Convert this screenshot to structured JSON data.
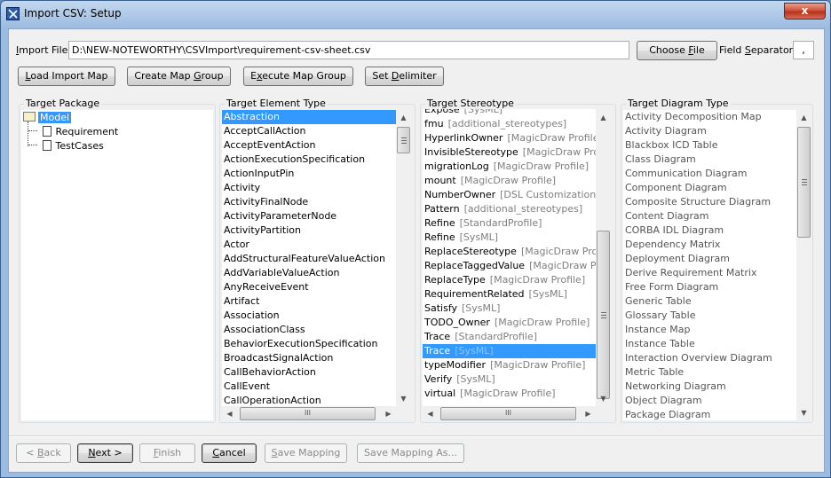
{
  "window": {
    "title": "Import CSV: Setup",
    "close_label": "x"
  },
  "import_file": {
    "label_pre": "",
    "label_u": "I",
    "label_post": "mport File:",
    "value": "D:\\NEW-NOTEWORTHY\\CSVImport\\requirement-csv-sheet.csv"
  },
  "choose_file": {
    "pre": "Choose ",
    "u": "F",
    "post": "ile"
  },
  "field_separator": {
    "pre": "Field ",
    "u": "S",
    "post": "eparator:",
    "value": ","
  },
  "toolbar": {
    "load_import_map": {
      "pre": "",
      "u": "L",
      "post": "oad Import Map"
    },
    "create_map_group": {
      "pre": "Create Map ",
      "u": "G",
      "post": "roup"
    },
    "execute_map_group": {
      "pre": "E",
      "u": "x",
      "post": "ecute Map Group"
    },
    "set_delimiter": {
      "pre": "Set ",
      "u": "D",
      "post": "elimiter"
    }
  },
  "target_package": {
    "title": "Target Package",
    "root": "Model",
    "children": [
      "Requirement",
      "TestCases"
    ]
  },
  "target_element_type": {
    "title": "Target Element Type",
    "selected": "Abstraction",
    "items": [
      "Abstraction",
      "AcceptCallAction",
      "AcceptEventAction",
      "ActionExecutionSpecification",
      "ActionInputPin",
      "Activity",
      "ActivityFinalNode",
      "ActivityParameterNode",
      "ActivityPartition",
      "Actor",
      "AddStructuralFeatureValueAction",
      "AddVariableValueAction",
      "AnyReceiveEvent",
      "Artifact",
      "Association",
      "AssociationClass",
      "BehaviorExecutionSpecification",
      "BroadcastSignalAction",
      "CallBehaviorAction",
      "CallEvent",
      "CallOperationAction"
    ]
  },
  "target_stereotype": {
    "title": "Target Stereotype",
    "selected_index": 17,
    "items": [
      {
        "name": "Expose",
        "profile": "[SysML]"
      },
      {
        "name": "fmu",
        "profile": "[additional_stereotypes]"
      },
      {
        "name": "HyperlinkOwner",
        "profile": "[MagicDraw Profile]"
      },
      {
        "name": "InvisibleStereotype",
        "profile": "[MagicDraw Profile]"
      },
      {
        "name": "migrationLog",
        "profile": "[MagicDraw Profile]"
      },
      {
        "name": "mount",
        "profile": "[MagicDraw Profile]"
      },
      {
        "name": "NumberOwner",
        "profile": "[DSL Customization]"
      },
      {
        "name": "Pattern",
        "profile": "[additional_stereotypes]"
      },
      {
        "name": "Refine",
        "profile": "[StandardProfile]"
      },
      {
        "name": "Refine",
        "profile": "[SysML]"
      },
      {
        "name": "ReplaceStereotype",
        "profile": "[MagicDraw Profile]"
      },
      {
        "name": "ReplaceTaggedValue",
        "profile": "[MagicDraw Profile]"
      },
      {
        "name": "ReplaceType",
        "profile": "[MagicDraw Profile]"
      },
      {
        "name": "RequirementRelated",
        "profile": "[SysML]"
      },
      {
        "name": "Satisfy",
        "profile": "[SysML]"
      },
      {
        "name": "TODO_Owner",
        "profile": "[MagicDraw Profile]"
      },
      {
        "name": "Trace",
        "profile": "[StandardProfile]"
      },
      {
        "name": "Trace",
        "profile": "[SysML]"
      },
      {
        "name": "typeModifier",
        "profile": "[MagicDraw Profile]"
      },
      {
        "name": "Verify",
        "profile": "[SysML]"
      },
      {
        "name": "virtual",
        "profile": "[MagicDraw Profile]"
      }
    ]
  },
  "target_diagram_type": {
    "title": "Target Diagram Type",
    "items": [
      "Activity Decomposition Map",
      "Activity Diagram",
      "Blackbox ICD Table",
      "Class Diagram",
      "Communication Diagram",
      "Component Diagram",
      "Composite Structure Diagram",
      "Content Diagram",
      "CORBA IDL Diagram",
      "Dependency Matrix",
      "Deployment Diagram",
      "Derive Requirement Matrix",
      "Free Form Diagram",
      "Generic Table",
      "Glossary Table",
      "Instance Map",
      "Instance Table",
      "Interaction Overview Diagram",
      "Metric Table",
      "Networking Diagram",
      "Object Diagram",
      "Package Diagram"
    ]
  },
  "footer": {
    "back": {
      "pre": "< ",
      "u": "B",
      "post": "ack",
      "enabled": false
    },
    "next": {
      "pre": "",
      "u": "N",
      "post": "ext >",
      "enabled": true
    },
    "finish": {
      "pre": "",
      "u": "F",
      "post": "inish",
      "enabled": false
    },
    "cancel": {
      "pre": "",
      "u": "C",
      "post": "ancel",
      "enabled": true
    },
    "save_mapping": {
      "pre": "",
      "u": "S",
      "post": "ave Mapping",
      "enabled": false
    },
    "save_mapping_as": {
      "pre": "Save Mapping As...",
      "u": "",
      "post": "",
      "enabled": false
    }
  },
  "scroll_glyphs": {
    "up": "▲",
    "down": "▼",
    "left": "◀",
    "right": "▶",
    "grip": "III"
  },
  "colors": {
    "selection": "#3399ff",
    "profile_text": "#7f7f7f",
    "close_button": "#c9472f"
  }
}
